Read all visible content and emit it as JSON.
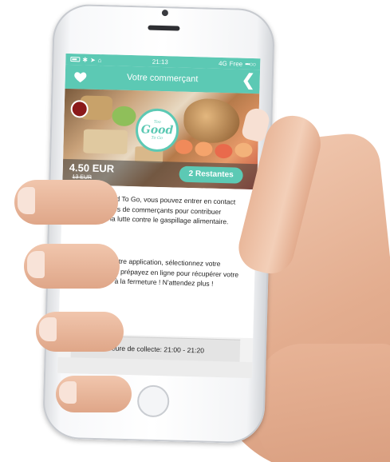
{
  "statusbar": {
    "signal_dots": "•••○○",
    "carrier": "Free",
    "network": "4G",
    "time": "21:13",
    "icons": [
      "alarm-icon",
      "lock-icon",
      "location-icon",
      "bluetooth-icon",
      "battery-icon"
    ]
  },
  "navbar": {
    "title": "Votre commerçant",
    "back_icon": "chevron-left-icon",
    "back_glyph": "❮",
    "favorite_icon": "heart-icon"
  },
  "offer": {
    "logo_top": "Too",
    "logo_main": "Good",
    "logo_bottom": "To Go",
    "remaining": "2 Restantes",
    "price": "4.50 EUR",
    "old_price": "13 EUR"
  },
  "description": {
    "paragraph1": "Avec Too Good To Go, vous pouvez entrer en contact avec tous types de commerçants pour contribuer ensemble à la lutte contre le gaspillage alimentaire.",
    "paragraph2": "Téléchargez notre application, sélectionnez votre commerçant, et prépayez en ligne pour récupérer votre boîte surprise à la fermeture ! N'attendez plus !"
  },
  "pickup": {
    "label": "Heure de collecte: 21:00 - 21:20"
  },
  "colors": {
    "accent": "#5cc9b4",
    "price_overlay": "#3c3c3c"
  }
}
